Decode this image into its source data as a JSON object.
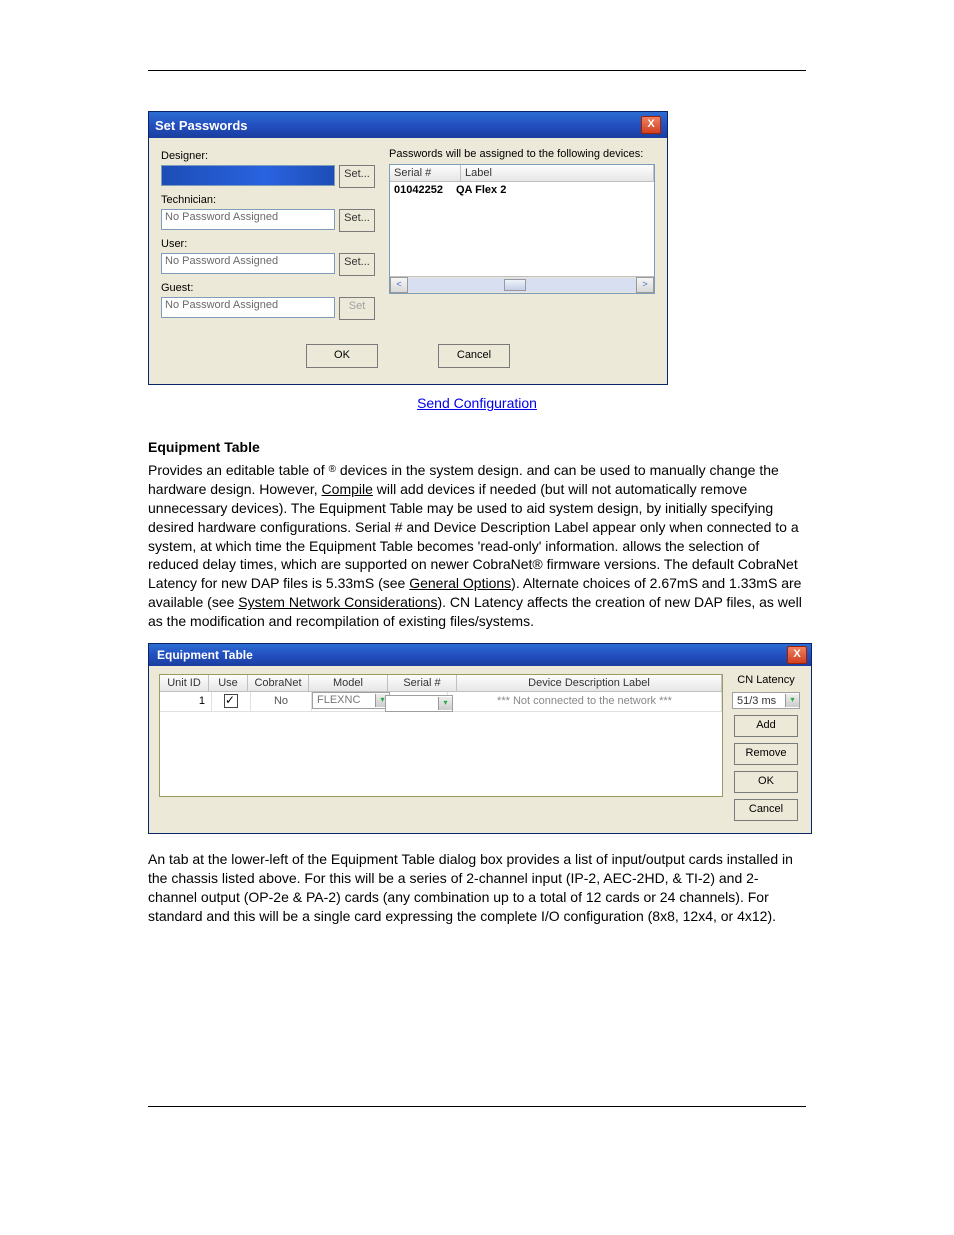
{
  "setPasswords": {
    "title": "Set Passwords",
    "roles": {
      "designer": {
        "label": "Designer:",
        "value": "",
        "set": "Set...",
        "selected": true,
        "disabled": false
      },
      "technician": {
        "label": "Technician:",
        "value": "No Password Assigned",
        "set": "Set...",
        "disabled": false
      },
      "user": {
        "label": "User:",
        "value": "No Password Assigned",
        "set": "Set...",
        "disabled": false
      },
      "guest": {
        "label": "Guest:",
        "value": "No Password Assigned",
        "set": "Set",
        "disabled": true
      }
    },
    "devicesHeader": "Passwords will be assigned to the following devices:",
    "devCols": {
      "serial": "Serial #",
      "label": "Label"
    },
    "devRow": {
      "serial": "01042252",
      "label": "QA Flex 2"
    },
    "ok": "OK",
    "cancel": "Cancel"
  },
  "captionLink": "Send Configuration",
  "equipHeading": "Equipment Table",
  "para1": {
    "t1": "Provides an editable table of ",
    "reg1": "®",
    "t2": " devices in the system design. ",
    "t3": " and ",
    "t4": " can be used to manually change the hardware design. However, ",
    "compile": "Compile",
    "t5": " will add devices if needed (but will not automatically remove unnecessary devices). The Equipment Table may be used to aid system design, by initially specifying desired hardware configurations. Serial # and Device Description Label appear only when connected to a system, at which time the Equipment Table becomes 'read-only' information. ",
    "t6": " allows the selection of reduced delay times, which are supported on newer CobraNet® firmware versions. The default CobraNet Latency for new DAP files is 5.33mS (see ",
    "genopt": "General Options",
    "t7": "). Alternate choices of 2.67mS and 1.33mS are available (see ",
    "sysnet": "System Network Considerations",
    "t8": "). CN Latency affects the creation of new DAP files, as well as the modification and recompilation of existing files/systems."
  },
  "equipDlg": {
    "title": "Equipment Table",
    "cols": {
      "unitid": "Unit ID",
      "use": "Use",
      "cobra": "CobraNet",
      "model": "Model",
      "serial": "Serial #",
      "desc": "Device Description Label"
    },
    "row": {
      "unitid": "1",
      "cobra": "No",
      "model": "FLEXNC",
      "serial": "",
      "desc": "*** Not connected to the network ***"
    },
    "cnLatencyLabel": "CN Latency",
    "cnLatencyValue": "51/3 ms",
    "add": "Add",
    "remove": "Remove",
    "ok": "OK",
    "cancel": "Cancel"
  },
  "para2": {
    "t1": "An ",
    "t2": " tab at the lower-left of the Equipment Table dialog box provides a list of input/output cards installed in the chassis listed above. For ",
    "t3": " this will be a series of 2-channel input (IP-2, AEC-2HD, & TI-2) and 2-channel output (OP-2e & PA-2) cards (any combination up to a total of 12 cards or 24 channels). For standard ",
    "t4": " and ",
    "t5": " this will be a single card expressing the complete I/O configuration (8x8, 12x4, or 4x12)."
  }
}
